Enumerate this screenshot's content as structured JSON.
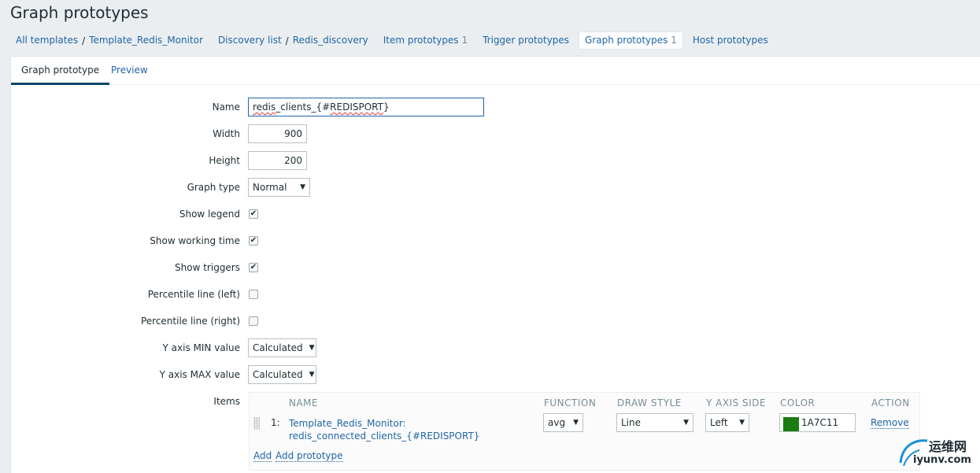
{
  "page": {
    "title": "Graph prototypes"
  },
  "nav": {
    "all_templates": "All templates",
    "sep": "/",
    "template": "Template_Redis_Monitor",
    "discovery_list": "Discovery list",
    "discovery": "Redis_discovery",
    "item_prototypes": "Item prototypes",
    "item_prototypes_count": "1",
    "trigger_prototypes": "Trigger prototypes",
    "graph_prototypes": "Graph prototypes",
    "graph_prototypes_count": "1",
    "host_prototypes": "Host prototypes"
  },
  "tabs": {
    "graph_prototype": "Graph prototype",
    "preview": "Preview"
  },
  "form": {
    "name_label": "Name",
    "name_value_a": "redis",
    "name_value_b": "_clients_{#",
    "name_value_c": "REDISPORT",
    "name_value_d": "}",
    "width_label": "Width",
    "width_value": "900",
    "height_label": "Height",
    "height_value": "200",
    "graph_type_label": "Graph type",
    "graph_type_value": "Normal",
    "show_legend_label": "Show legend",
    "show_working_time_label": "Show working time",
    "show_triggers_label": "Show triggers",
    "percentile_left_label": "Percentile line (left)",
    "percentile_right_label": "Percentile line (right)",
    "ymin_label": "Y axis MIN value",
    "ymin_value": "Calculated",
    "ymax_label": "Y axis MAX value",
    "ymax_value": "Calculated",
    "items_label": "Items",
    "check_mark": "✔"
  },
  "items_table": {
    "headers": {
      "name": "NAME",
      "function": "FUNCTION",
      "draw_style": "DRAW STYLE",
      "y_axis_side": "Y AXIS SIDE",
      "color": "COLOR",
      "action": "ACTION"
    },
    "rows": [
      {
        "num": "1:",
        "name_line1": "Template_Redis_Monitor:",
        "name_line2": "redis_connected_clients_{#REDISPORT}",
        "function": "avg",
        "draw_style": "Line",
        "y_axis_side": "Left",
        "color_hex": "1A7C11",
        "remove": "Remove"
      }
    ],
    "add": "Add",
    "add_prototype": "Add prototype"
  },
  "watermark": {
    "cn": "运维网",
    "url": "iyunv.com"
  }
}
